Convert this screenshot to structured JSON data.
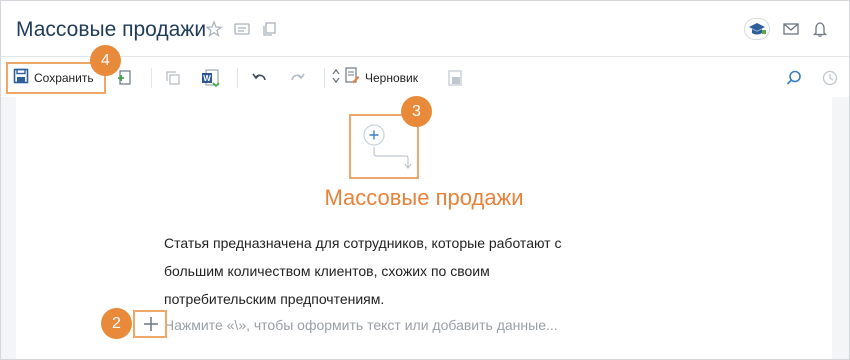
{
  "header": {
    "title": "Массовые продажи"
  },
  "toolbar": {
    "save_label": "Сохранить",
    "draft_label": "Черновик"
  },
  "document": {
    "title": "Массовые продажи",
    "paragraph_lines": [
      "Статья предназначена для сотрудников, которые работают с",
      "большим количеством клиентов,  схожих по своим",
      "потребительским предпочтениям."
    ],
    "placeholder": "Нажмите «\\», чтобы оформить текст или добавить данные..."
  },
  "callouts": {
    "badge_2": "2",
    "badge_3": "3",
    "badge_4": "4"
  },
  "colors": {
    "accent": "#e8823a",
    "title": "#1f3c5b",
    "link_blue": "#3b7fc4"
  }
}
